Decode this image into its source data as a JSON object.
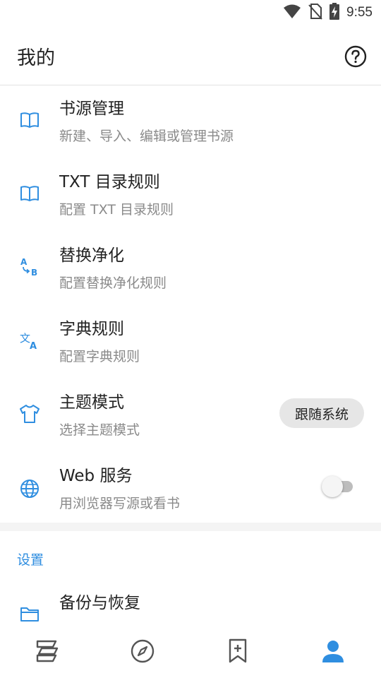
{
  "status_bar": {
    "time": "9:55",
    "icons": [
      "wifi-icon",
      "no-sim-icon",
      "battery-charging-icon"
    ]
  },
  "header": {
    "title": "我的",
    "help_icon": "help-circle-icon"
  },
  "items": [
    {
      "icon": "book-open-icon",
      "title": "书源管理",
      "subtitle": "新建、导入、编辑或管理书源"
    },
    {
      "icon": "book-open-icon",
      "title": "TXT 目录规则",
      "subtitle": "配置 TXT 目录规则"
    },
    {
      "icon": "replace-ab-icon",
      "title": "替换净化",
      "subtitle": "配置替换净化规则"
    },
    {
      "icon": "translate-icon",
      "title": "字典规则",
      "subtitle": "配置字典规则"
    },
    {
      "icon": "tshirt-icon",
      "title": "主题模式",
      "subtitle": "选择主题模式",
      "value": "跟随系统"
    },
    {
      "icon": "globe-icon",
      "title": "Web 服务",
      "subtitle": "用浏览器写源或看书",
      "toggle": false
    }
  ],
  "settings_section": {
    "header": "设置",
    "items": [
      {
        "icon": "folder-icon",
        "title": "备份与恢复"
      }
    ]
  },
  "bottom_nav": {
    "items": [
      "bookshelf-icon",
      "explore-compass-icon",
      "bookmark-add-icon",
      "person-icon"
    ],
    "active_index": 3
  },
  "colors": {
    "accent": "#2f8ee0",
    "text_primary": "#222222",
    "text_secondary": "#8a8a8a",
    "nav_inactive": "#555555"
  }
}
